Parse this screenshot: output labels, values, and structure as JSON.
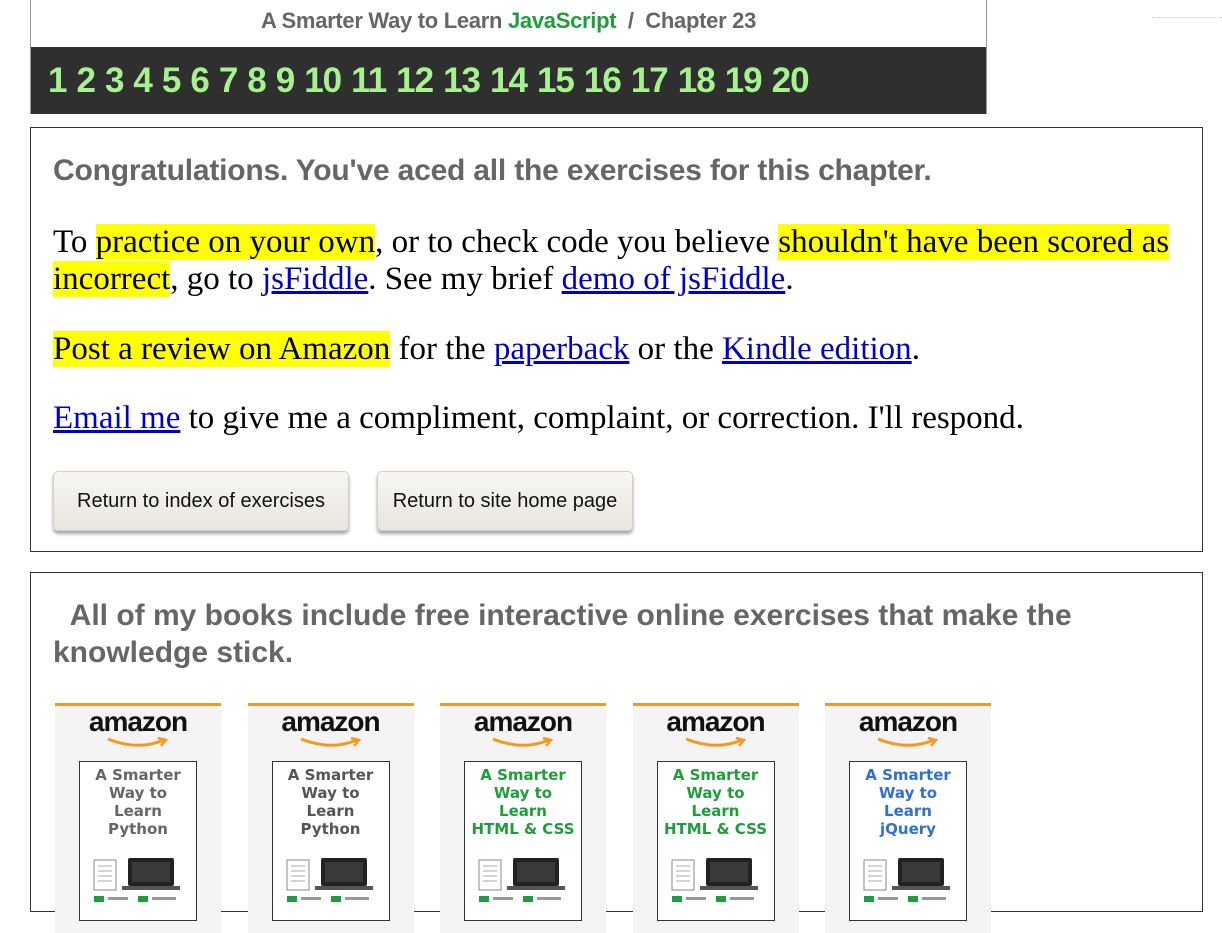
{
  "header": {
    "title_prefix": "A Smarter Way to Learn ",
    "title_js": "JavaScript",
    "title_suffix": "  /  Chapter 23",
    "chapters": [
      "1",
      "2",
      "3",
      "4",
      "5",
      "6",
      "7",
      "8",
      "9",
      "10",
      "11",
      "12",
      "13",
      "14",
      "15",
      "16",
      "17",
      "18",
      "19",
      "20"
    ]
  },
  "congrats": {
    "heading": "Congratulations. You've aced all the exercises for this chapter.",
    "p1_a": "To ",
    "p1_hl1": "practice on your own",
    "p1_b": ", or to check code you believe ",
    "p1_hl2": "shouldn't have been scored as incorrect",
    "p1_c": ", go to ",
    "p1_link1": "jsFiddle",
    "p1_d": ". See my brief ",
    "p1_link2": "demo of jsFiddle",
    "p1_e": ".",
    "p2_hl": "Post a review on Amazon",
    "p2_a": " for the ",
    "p2_link1": "paperback",
    "p2_b": " or the ",
    "p2_link2": "Kindle edition",
    "p2_c": ".",
    "p3_link": "Email me",
    "p3_a": " to give me a compliment, complaint, or correction. I'll respond.",
    "btn_index": "Return to index of exercises",
    "btn_home": "Return to site home page"
  },
  "books": {
    "heading": "  All of my books include free interactive online exercises that make the knowledge stick.",
    "items": [
      {
        "store": "amazon",
        "title": "A Smarter\nWay to\nLearn\nPython",
        "color": "#666666"
      },
      {
        "store": "amazon",
        "title": "A Smarter\nWay to\nLearn\nPython",
        "color": "#555555"
      },
      {
        "store": "amazon",
        "title": "A Smarter\nWay to\nLearn\nHTML & CSS",
        "color": "#1e9e3a"
      },
      {
        "store": "amazon",
        "title": "A Smarter\nWay to\nLearn\nHTML & CSS",
        "color": "#1e9e3a"
      },
      {
        "store": "amazon",
        "title": "A Smarter\nWay to\nLearn\njQuery",
        "color": "#2f6fd6"
      }
    ]
  },
  "colors": {
    "highlight": "#ffff00",
    "link": "#0000cc",
    "chapter_green": "#a5f28f",
    "amazon_orange": "#f29a1f"
  }
}
